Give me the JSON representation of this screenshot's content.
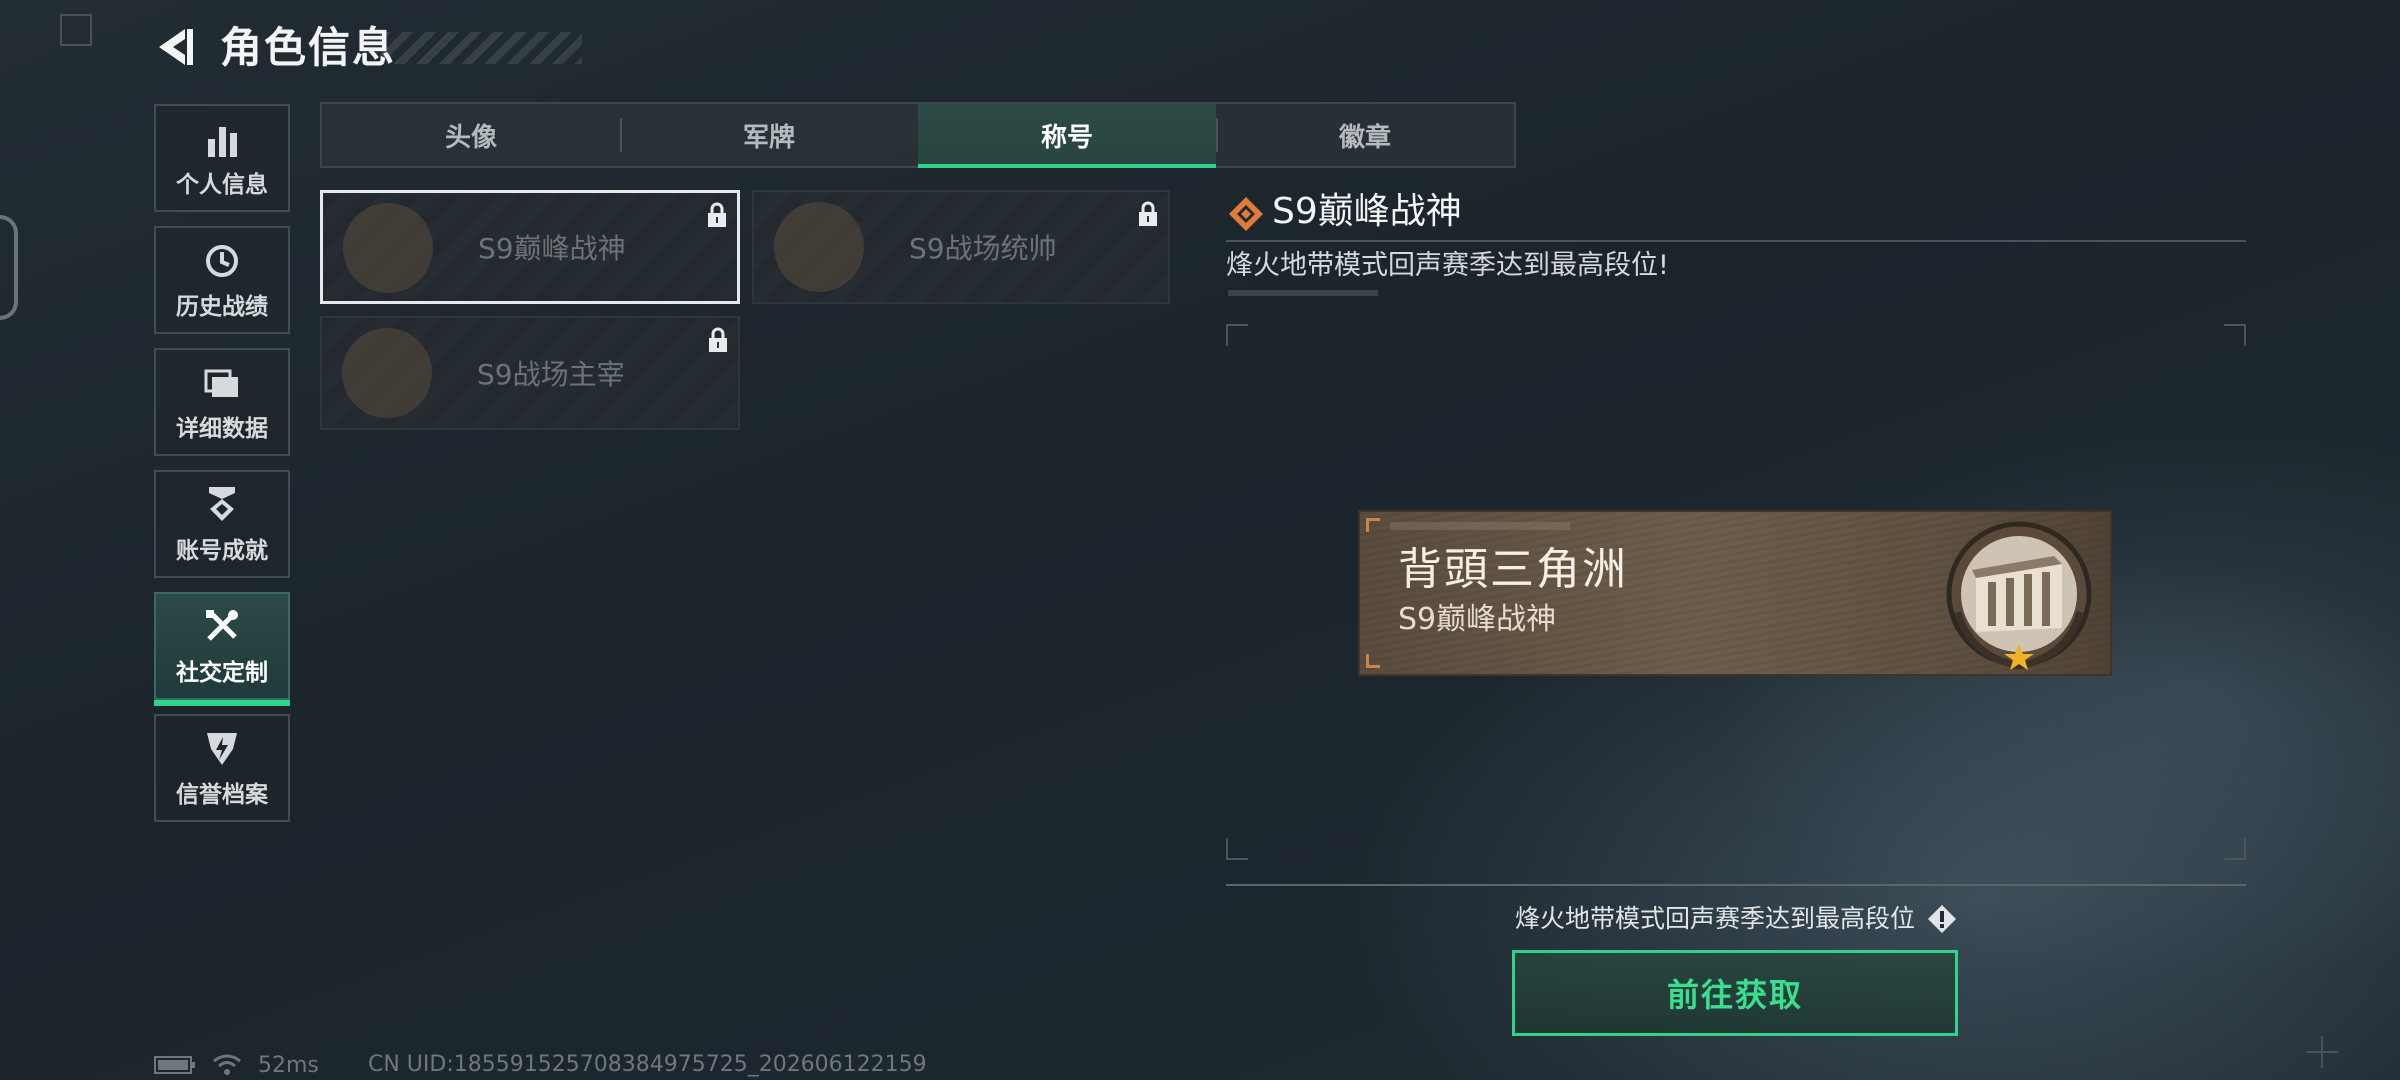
{
  "header": {
    "title": "角色信息",
    "back_icon": "back-arrow-icon"
  },
  "sidebar": {
    "items": [
      {
        "label": "个人信息",
        "icon": "bar-chart-icon",
        "active": false
      },
      {
        "label": "历史战绩",
        "icon": "clock-history-icon",
        "active": false
      },
      {
        "label": "详细数据",
        "icon": "folder-icon",
        "active": false
      },
      {
        "label": "账号成就",
        "icon": "medal-icon",
        "active": false
      },
      {
        "label": "社交定制",
        "icon": "tools-icon",
        "active": true
      },
      {
        "label": "信誉档案",
        "icon": "shield-lightning-icon",
        "active": false
      }
    ]
  },
  "tabs": [
    {
      "label": "头像",
      "active": false
    },
    {
      "label": "军牌",
      "active": false
    },
    {
      "label": "称号",
      "active": true
    },
    {
      "label": "徽章",
      "active": false
    }
  ],
  "titles": [
    {
      "name": "S9巅峰战神",
      "locked": true,
      "selected": true
    },
    {
      "name": "S9战场统帅",
      "locked": true,
      "selected": false
    },
    {
      "name": "S9战场主宰",
      "locked": true,
      "selected": false
    }
  ],
  "detail": {
    "title": "S9巅峰战神",
    "description": "烽火地带模式回声赛季达到最高段位!",
    "nameplate": {
      "player_name": "背頭三角洲",
      "title": "S9巅峰战神"
    },
    "requirement": "烽火地带模式回声赛季达到最高段位",
    "action_label": "前往获取"
  },
  "status": {
    "ping": "52ms",
    "uid": "CN UID:185591525708384975725_202606122159"
  },
  "colors": {
    "accent": "#2fd48a",
    "title_icon": "#e07b3a",
    "plate": "#6a5a48"
  }
}
